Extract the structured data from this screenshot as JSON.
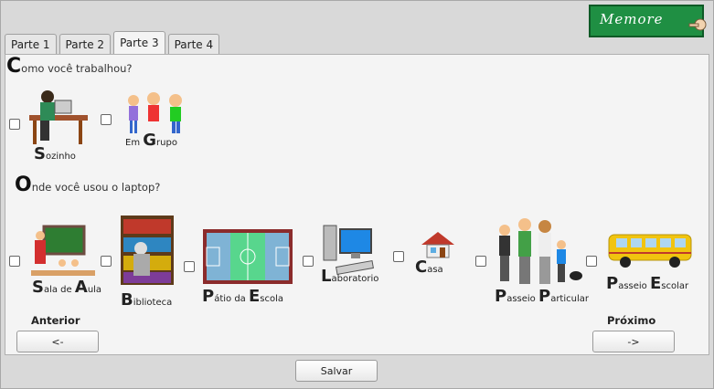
{
  "logo": {
    "text": "Memore",
    "bg_color": "#1f8f43"
  },
  "tabs": [
    {
      "label": "Parte 1",
      "active": false
    },
    {
      "label": "Parte 2",
      "active": false
    },
    {
      "label": "Parte 3",
      "active": true
    },
    {
      "label": "Parte 4",
      "active": false
    }
  ],
  "q1": {
    "cap": "C",
    "rest": "omo você trabalhou?",
    "options": [
      {
        "cap": "S",
        "rest": "ozinho",
        "prefix": "",
        "icon": "person-at-desk-icon"
      },
      {
        "prefix": "Em ",
        "cap": "G",
        "rest": "rupo",
        "icon": "group-of-kids-icon"
      }
    ]
  },
  "q2": {
    "cap": "O",
    "rest": "nde você usou o laptop?",
    "options": [
      {
        "cap": "S",
        "rest1": "ala de ",
        "cap2": "A",
        "rest2": "ula",
        "icon": "classroom-icon"
      },
      {
        "cap": "B",
        "rest1": "iblioteca",
        "icon": "library-icon"
      },
      {
        "cap": "P",
        "rest1": "átio da ",
        "cap2": "E",
        "rest2": "scola",
        "icon": "court-icon"
      },
      {
        "cap": "L",
        "rest1": "aboratorio",
        "icon": "computer-icon"
      },
      {
        "cap": "C",
        "rest1": "asa",
        "icon": "house-icon"
      },
      {
        "cap": "P",
        "rest1": "asseio ",
        "cap2": "P",
        "rest2": "articular",
        "icon": "family-icon"
      },
      {
        "cap": "P",
        "rest1": "asseio ",
        "cap2": "E",
        "rest2": "scolar",
        "icon": "school-bus-icon"
      }
    ]
  },
  "nav": {
    "prev_title": "Anterior",
    "prev_button": "<-",
    "next_title": "Próximo",
    "next_button": "->",
    "save_button": "Salvar"
  }
}
